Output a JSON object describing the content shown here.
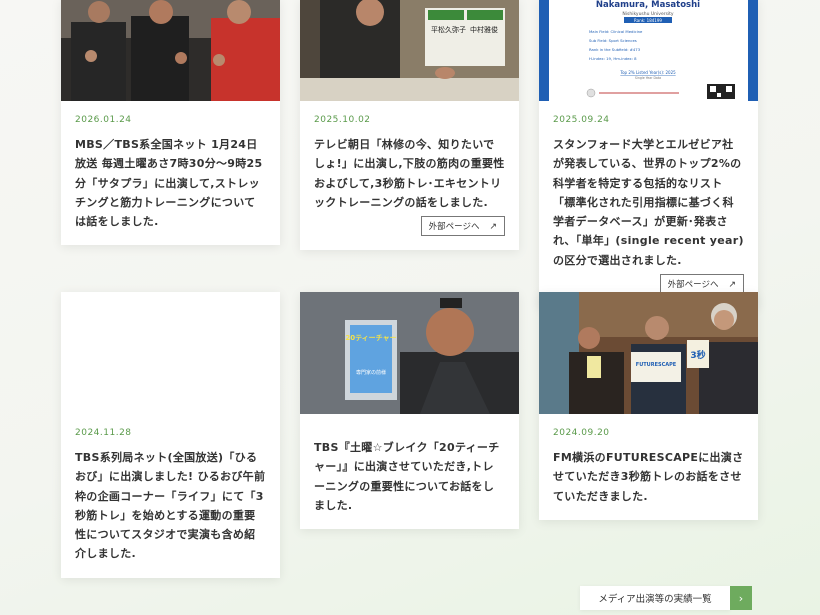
{
  "cards": [
    {
      "date": "2026.01.24",
      "text": "MBS／TBS系全国ネット 1月24日放送 毎週土曜あさ7時30分〜9時25分「サタプラ」に出演して,ストレッチングと筋力トレーニングについては話をしました.",
      "external_label": ""
    },
    {
      "date": "2025.10.02",
      "text": "テレビ朝日「林修の今、知りたいでしょ!」に出演し,下肢の筋肉の重要性およびして,3秒筋トレ･エキセントリックトレーニングの話をしました.",
      "external_label": "外部ページへ"
    },
    {
      "date": "2025.09.24",
      "text": "スタンフォード大学とエルゼビア社が発表している、世界のトップ2%の科学者を特定する包括的なリスト「標準化された引用指標に基づく科学者データベース」が更新･発表され、「単年」(single recent year)の区分で選出されました.",
      "external_label": "外部ページへ"
    },
    {
      "date": "2024.11.28",
      "text": "TBS系列局ネット(全国放送)「ひるおび」に出演しました! ひるおび午前枠の企画コーナー「ライフ」にて「3秒筋トレ」を始めとする運動の重要性についてスタジオで実演も含め紹介しました.",
      "external_label": ""
    },
    {
      "date": "",
      "text": "TBS『土曜☆ブレイク「20ティーチャー」』に出演させていただき,トレーニングの重要性についてお話をしました.",
      "external_label": ""
    },
    {
      "date": "2024.09.20",
      "text": "FM横浜のFUTURESCAPEに出演させていただき3秒筋トレのお話をさせていただきました.",
      "external_label": ""
    }
  ],
  "thumb_texts": {
    "cert_name": "Nakamura, Masatoshi",
    "cert_univ": "Nishikyushu University",
    "cert_rank": "Rank: 184199",
    "cert_lines": [
      "Main Field: Clinical Medicine",
      "Sub Field: Sport Sciences",
      "Rank in the Subfield: #473",
      "H-index: 19, Hm-index: 8"
    ],
    "cert_top": "Top 2% Listed Year(s): 2025",
    "cert_single": "Single Year Data",
    "sign_1": "平松久弥子",
    "sign_2": "中村雅俊",
    "tv_screen_1": "20ティーチャー",
    "tv_screen_2": "専門家の前様",
    "radio_board": "FUTURESCAPE",
    "radio_book": "3秒"
  },
  "more_button": {
    "label": "メディア出演等の実績一覧",
    "arrow": "›"
  },
  "icons": {
    "external": "external-link-icon",
    "chevron": "chevron-right-icon"
  },
  "colors": {
    "accent_green": "#6eab5e",
    "date_green": "#5a9a4a",
    "cert_blue": "#1f5fb4"
  }
}
